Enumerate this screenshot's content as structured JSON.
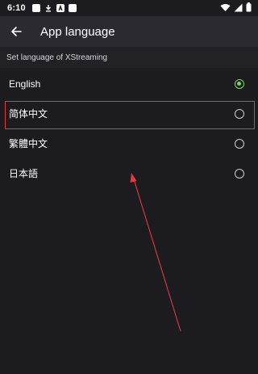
{
  "status_bar": {
    "time": "6:10",
    "notification_icons": [
      "app-notification-icon",
      "download-icon",
      "a-badge-icon",
      "square-notification-icon"
    ],
    "system_icons": [
      "wifi-icon",
      "signal-icon",
      "battery-icon"
    ]
  },
  "app_bar": {
    "back_icon": "arrow-left-icon",
    "title": "App language"
  },
  "section": {
    "title": "Set language of XStreaming"
  },
  "options": [
    {
      "label": "English",
      "selected": true
    },
    {
      "label": "简体中文",
      "selected": false
    },
    {
      "label": "繁體中文",
      "selected": false
    },
    {
      "label": "日本語",
      "selected": false
    }
  ],
  "colors": {
    "background": "#1c1b1f",
    "app_bar": "#2b2a30",
    "selected_radio": "#7fd35a",
    "highlight": "#e23a3a"
  },
  "annotation": {
    "highlighted_option": "简体中文",
    "arrow_color": "#e23a3a"
  }
}
